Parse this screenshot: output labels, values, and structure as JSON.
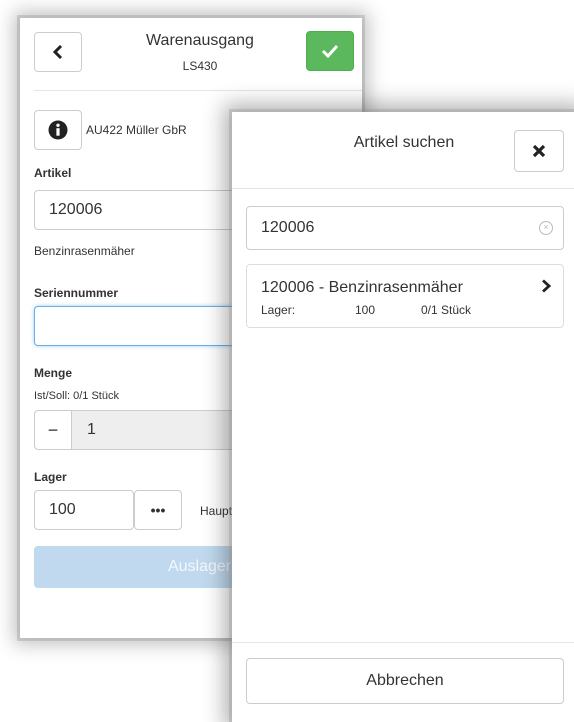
{
  "header": {
    "title": "Warenausgang",
    "subtitle": "LS430"
  },
  "customer": "AU422 Müller GbR",
  "article": {
    "label": "Artikel",
    "value": "120006",
    "description": "Benzinrasenmäher"
  },
  "serial": {
    "label": "Seriennummer",
    "value": ""
  },
  "quantity": {
    "label": "Menge",
    "info": "Ist/Soll: 0/1 Stück",
    "minus": "−",
    "value": "1"
  },
  "storage": {
    "label": "Lager",
    "value": "100",
    "more": "•••",
    "name": "Haupt"
  },
  "book_button": "Auslagern",
  "modal": {
    "title": "Artikel suchen",
    "search_value": "120006",
    "result": {
      "title": "120006 - Benzinrasenmäher",
      "lager_label": "Lager:",
      "lager_value": "100",
      "qty": "0/1 Stück"
    },
    "cancel": "Abbrechen"
  },
  "colors": {
    "accent_green": "#5cb85c",
    "focus_blue": "#66afe9",
    "disabled_blue": "#c0d9ee"
  },
  "icons": [
    "chevron-left-icon",
    "check-icon",
    "info-icon",
    "close-icon",
    "clear-icon",
    "chevron-right-icon"
  ]
}
